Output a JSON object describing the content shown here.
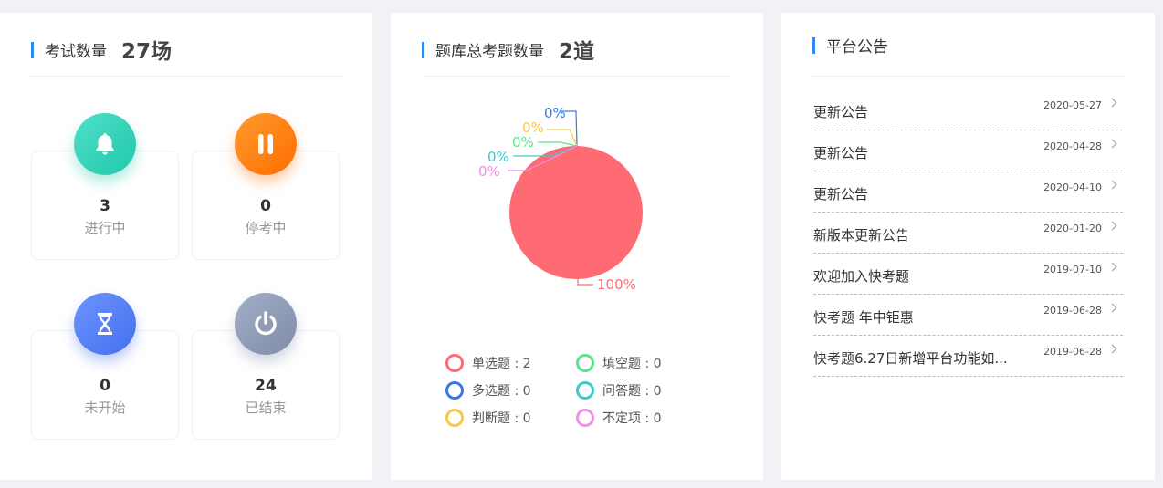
{
  "exam_card": {
    "title": "考试数量",
    "count": "27场",
    "stats": [
      {
        "value": "3",
        "label": "进行中",
        "icon": "bell-icon",
        "color": "#2fd2b8"
      },
      {
        "value": "0",
        "label": "停考中",
        "icon": "pause-icon",
        "color": "#ff7a0f"
      },
      {
        "value": "0",
        "label": "未开始",
        "icon": "hourglass-icon",
        "color": "#5680f6"
      },
      {
        "value": "24",
        "label": "已结束",
        "icon": "power-icon",
        "color": "#8e9bb6"
      }
    ]
  },
  "bank_card": {
    "title": "题库总考题数量",
    "count": "2道"
  },
  "chart_data": {
    "type": "pie",
    "slices": [
      {
        "name": "单选题",
        "value": 2,
        "percent_label": "100%",
        "color": "#ff6b72"
      },
      {
        "name": "多选题",
        "value": 0,
        "percent_label": "0%",
        "color": "#3b78e7"
      },
      {
        "name": "判断题",
        "value": 0,
        "percent_label": "0%",
        "color": "#f7c948"
      },
      {
        "name": "填空题",
        "value": 0,
        "percent_label": "0%",
        "color": "#5ee08f"
      },
      {
        "name": "问答题",
        "value": 0,
        "percent_label": "0%",
        "color": "#3dc9cd"
      },
      {
        "name": "不定项",
        "value": 0,
        "percent_label": "0%",
        "color": "#f08fe4"
      }
    ],
    "legend": [
      {
        "text": "单选题 : 2",
        "color": "#ff6b72"
      },
      {
        "text": "填空题 : 0",
        "color": "#5ee08f"
      },
      {
        "text": "多选题 : 0",
        "color": "#3b78e7"
      },
      {
        "text": "问答题 : 0",
        "color": "#3dc9cd"
      },
      {
        "text": "判断题 : 0",
        "color": "#f7c948"
      },
      {
        "text": "不定项 : 0",
        "color": "#f08fe4"
      }
    ]
  },
  "notice_card": {
    "title": "平台公告",
    "items": [
      {
        "title": "更新公告",
        "date": "2020-05-27"
      },
      {
        "title": "更新公告",
        "date": "2020-04-28"
      },
      {
        "title": "更新公告",
        "date": "2020-04-10"
      },
      {
        "title": "新版本更新公告",
        "date": "2020-01-20"
      },
      {
        "title": "欢迎加入快考题",
        "date": "2019-07-10"
      },
      {
        "title": "快考题 年中钜惠",
        "date": "2019-06-28"
      },
      {
        "title": "快考题6.27日新增平台功能如...",
        "date": "2019-06-28"
      }
    ]
  }
}
